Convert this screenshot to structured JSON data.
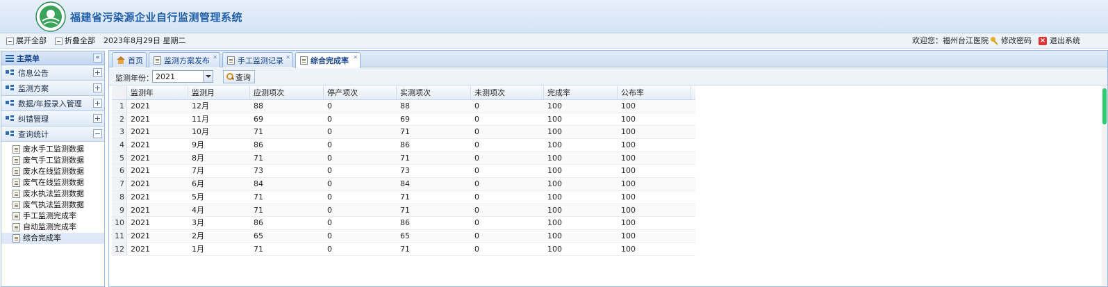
{
  "header": {
    "logo_label": "",
    "title": "福建省污染源企业自行监测管理系统"
  },
  "toolbar": {
    "expand_all": "展开全部",
    "collapse_all": "折叠全部",
    "date": "2023年8月29日 星期二",
    "welcome": "欢迎您：福州台江医院",
    "change_password": "修改密码",
    "logout": "退出系统"
  },
  "nav": {
    "title": "主菜单",
    "collapse_symbol": "«",
    "groups": [
      {
        "label": "信息公告",
        "toggle": "+"
      },
      {
        "label": "监测方案",
        "toggle": "+"
      },
      {
        "label": "数据/年报录入管理",
        "toggle": "+"
      },
      {
        "label": "纠错管理",
        "toggle": "+"
      },
      {
        "label": "查询统计",
        "toggle": "−"
      }
    ],
    "leaves": [
      "废水手工监测数据",
      "废气手工监测数据",
      "废水在线监测数据",
      "废气在线监测数据",
      "废水执法监测数据",
      "废气执法监测数据",
      "手工监测完成率",
      "自动监测完成率",
      "综合完成率"
    ]
  },
  "tabs": [
    {
      "label": "首页"
    },
    {
      "label": "监测方案发布"
    },
    {
      "label": "手工监测记录"
    },
    {
      "label": "综合完成率"
    }
  ],
  "query": {
    "year_label": "监测年份：",
    "year_value": "2021",
    "button": "查询"
  },
  "grid": {
    "columns": [
      "监测年",
      "监测月",
      "应测项次",
      "停产项次",
      "实测项次",
      "未测项次",
      "完成率",
      "公布率"
    ],
    "rows": [
      [
        "1",
        "2021",
        "12月",
        "88",
        "0",
        "88",
        "0",
        "100",
        "100"
      ],
      [
        "2",
        "2021",
        "11月",
        "69",
        "0",
        "69",
        "0",
        "100",
        "100"
      ],
      [
        "3",
        "2021",
        "10月",
        "71",
        "0",
        "71",
        "0",
        "100",
        "100"
      ],
      [
        "4",
        "2021",
        "9月",
        "86",
        "0",
        "86",
        "0",
        "100",
        "100"
      ],
      [
        "5",
        "2021",
        "8月",
        "71",
        "0",
        "71",
        "0",
        "100",
        "100"
      ],
      [
        "6",
        "2021",
        "7月",
        "73",
        "0",
        "73",
        "0",
        "100",
        "100"
      ],
      [
        "7",
        "2021",
        "6月",
        "84",
        "0",
        "84",
        "0",
        "100",
        "100"
      ],
      [
        "8",
        "2021",
        "5月",
        "71",
        "0",
        "71",
        "0",
        "100",
        "100"
      ],
      [
        "9",
        "2021",
        "4月",
        "71",
        "0",
        "71",
        "0",
        "100",
        "100"
      ],
      [
        "10",
        "2021",
        "3月",
        "86",
        "0",
        "86",
        "0",
        "100",
        "100"
      ],
      [
        "11",
        "2021",
        "2月",
        "65",
        "0",
        "65",
        "0",
        "100",
        "100"
      ],
      [
        "12",
        "2021",
        "1月",
        "71",
        "0",
        "71",
        "0",
        "100",
        "100"
      ]
    ]
  },
  "colors": {
    "accent": "#1f5fa8",
    "border": "#99bbe8",
    "scroll_thumb": "#2ecc71"
  }
}
